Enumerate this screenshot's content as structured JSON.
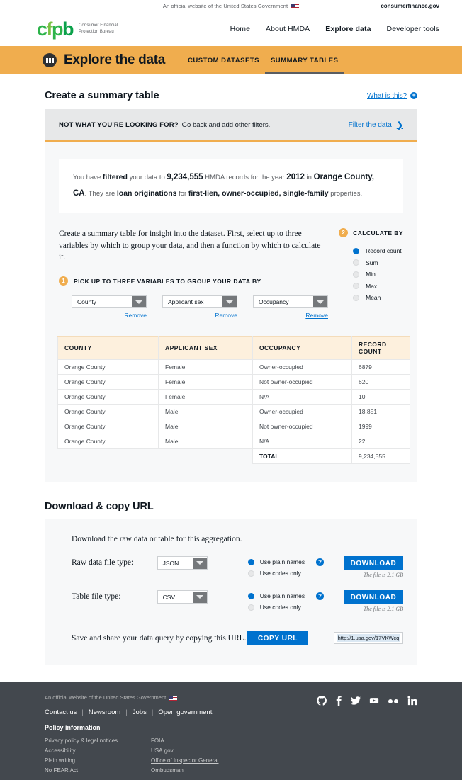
{
  "gov_banner": {
    "text": "An official website of the United States Government",
    "flag_icon": "us-flag-icon",
    "right_link": "consumerfinance.gov"
  },
  "mainnav": {
    "logo": {
      "text": "cfpb",
      "tagline_line1": "Consumer Financial",
      "tagline_line2": "Protection Bureau"
    },
    "links": [
      {
        "label": "Home",
        "active": false
      },
      {
        "label": "About HMDA",
        "active": false
      },
      {
        "label": "Explore data",
        "active": true
      },
      {
        "label": "Developer tools",
        "active": false
      }
    ]
  },
  "hero": {
    "icon": "data-table-download-icon",
    "title": "Explore the data",
    "tabs": [
      {
        "label": "CUSTOM DATASETS",
        "active": false
      },
      {
        "label": "SUMMARY TABLES",
        "active": true
      }
    ],
    "bg_color": "#f0ad4e"
  },
  "main": {
    "page_title": "Create a summary table",
    "what_is_this": {
      "label": "What is this?",
      "icon": "plus-circle-icon"
    },
    "notice": {
      "strong": "NOT WHAT YOU'RE LOOKING FOR?",
      "rest": "Go back and add other filters.",
      "link": "Filter the data",
      "chevron_icon": "chevron-right-icon"
    },
    "filter_summary": {
      "t1": "You have ",
      "b1": "filtered",
      "t2": " your data to ",
      "b2": "9,234,555",
      "t3": " HMDA records for the year ",
      "b3": "2012",
      "t4": " in ",
      "b4": "Orange County, CA",
      "t5": ". They are ",
      "b5": "loan originations",
      "t6": " for ",
      "b6": "first-lien, owner-occupied, single-family",
      "t7": " properties."
    },
    "intro_text": "Create a summary table for insight into the dataset. First, select up to three variables by which to group your data, and then a function by which to calculate it.",
    "step1": {
      "num": "1",
      "label": "PICK UP TO THREE VARIABLES TO GROUP YOUR DATA BY"
    },
    "group_selects": [
      {
        "value": "County",
        "remove": "Remove",
        "underlined": false
      },
      {
        "value": "Applicant sex",
        "remove": "Remove",
        "underlined": false
      },
      {
        "value": "Occupancy",
        "remove": "Remove",
        "underlined": true
      }
    ],
    "step2": {
      "num": "2",
      "label": "CALCULATE BY"
    },
    "calculate_options": [
      {
        "label": "Record count",
        "selected": true
      },
      {
        "label": "Sum",
        "selected": false
      },
      {
        "label": "Min",
        "selected": false
      },
      {
        "label": "Max",
        "selected": false
      },
      {
        "label": "Mean",
        "selected": false
      }
    ]
  },
  "table": {
    "headers": [
      "COUNTY",
      "APPLICANT SEX",
      "OCCUPANCY",
      "RECORD COUNT"
    ],
    "rows": [
      [
        "Orange County",
        "Female",
        "Owner-occupied",
        "6879"
      ],
      [
        "Orange County",
        "Female",
        "Not owner-occupied",
        "620"
      ],
      [
        "Orange County",
        "Female",
        "N/A",
        "10"
      ],
      [
        "Orange County",
        "Male",
        "Owner-occupied",
        "18,851"
      ],
      [
        "Orange County",
        "Male",
        "Not owner-occupied",
        "1999"
      ],
      [
        "Orange County",
        "Male",
        "N/A",
        "22"
      ]
    ],
    "total_label": "TOTAL",
    "total_value": "9,234,555"
  },
  "download": {
    "title": "Download & copy URL",
    "subtitle": "Download the raw data or table for this aggregation.",
    "rows": [
      {
        "label": "Raw data file type:",
        "select_value": "JSON",
        "radio1": "Use plain names",
        "radio2": "Use codes only",
        "help_icon": "question-circle-icon",
        "button": "DOWNLOAD",
        "filesize": "The file is 2.1 GB"
      },
      {
        "label": "Table file type:",
        "select_value": "CSV",
        "radio1": "Use plain names",
        "radio2": "Use codes only",
        "help_icon": "question-circle-icon",
        "button": "DOWNLOAD",
        "filesize": "The file is 2.1 GB"
      }
    ],
    "url_text": "Save and share your data query by copying this URL.",
    "copy_button": "COPY URL",
    "url_value": "http://1.usa.gov/17VKWcq"
  },
  "footer": {
    "gov_text": "An official website of the United States Government",
    "links": [
      "Contact us",
      "Newsroom",
      "Jobs",
      "Open government"
    ],
    "policy_title": "Policy information",
    "col1": [
      {
        "label": "Privacy policy & legal notices",
        "underline": false
      },
      {
        "label": "Accessibility",
        "underline": false
      },
      {
        "label": "Plain writing",
        "underline": false
      },
      {
        "label": "No FEAR Act",
        "underline": false
      }
    ],
    "col2": [
      {
        "label": "FOIA",
        "underline": false
      },
      {
        "label": "USA.gov",
        "underline": false
      },
      {
        "label": "Office of Inspector General",
        "underline": true
      },
      {
        "label": "Ombudsman",
        "underline": false
      }
    ],
    "socials": [
      "github-icon",
      "facebook-icon",
      "twitter-icon",
      "youtube-icon",
      "flickr-icon",
      "linkedin-icon"
    ]
  }
}
